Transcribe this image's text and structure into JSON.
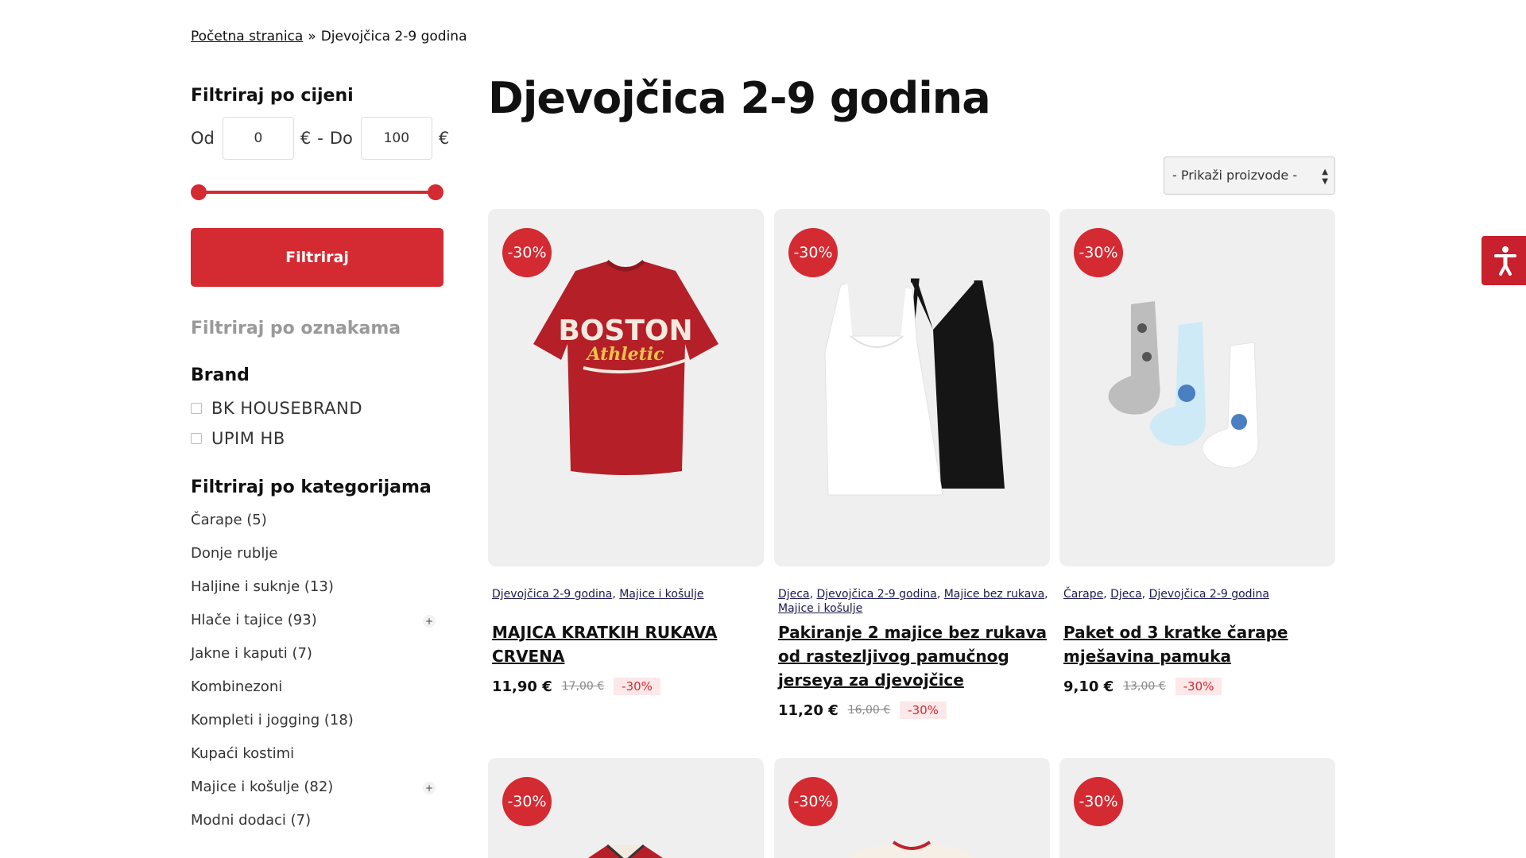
{
  "breadcrumb": {
    "home": "Početna stranica",
    "separator": "»",
    "current": "Djevojčica 2-9 godina"
  },
  "sidebar": {
    "price_title": "Filtriraj po cijeni",
    "price_from_label": "Od",
    "price_from_value": "0",
    "currency": "€",
    "dash": "-",
    "price_to_label": "Do",
    "price_to_value": "100",
    "filter_button": "Filtriraj",
    "tags_title": "Filtriraj po oznakama",
    "brand_title": "Brand",
    "brands": [
      "BK HOUSEBRAND",
      "UPIM HB"
    ],
    "categories_title": "Filtriraj po kategorijama",
    "categories": [
      {
        "label": "Čarape (5)",
        "expandable": false
      },
      {
        "label": "Donje rublje",
        "expandable": false
      },
      {
        "label": "Haljine i suknje (13)",
        "expandable": false
      },
      {
        "label": "Hlače i tajice (93)",
        "expandable": true
      },
      {
        "label": "Jakne i kaputi (7)",
        "expandable": false
      },
      {
        "label": "Kombinezoni",
        "expandable": false
      },
      {
        "label": "Kompleti i jogging (18)",
        "expandable": false
      },
      {
        "label": "Kupaći kostimi",
        "expandable": false
      },
      {
        "label": "Majice i košulje (82)",
        "expandable": true
      },
      {
        "label": "Modni dodaci (7)",
        "expandable": false
      }
    ],
    "expand_symbol": "+"
  },
  "main": {
    "title": "Djevojčica 2-9 godina",
    "sort_select": "- Prikaži proizvode -",
    "products": [
      {
        "badge": "-30%",
        "cats": [
          "Djevojčica 2-9 godina",
          "Majice i košulje"
        ],
        "name": "MAJICA KRATKIH RUKAVA CRVENA",
        "price": "11,90 €",
        "old_price": "17,00 €",
        "discount": "-30%"
      },
      {
        "badge": "-30%",
        "cats": [
          "Djeca",
          "Djevojčica 2-9 godina",
          "Majice bez rukava",
          "Majice i košulje"
        ],
        "name": "Pakiranje 2 majice bez rukava od rastezljivog pamučnog jerseya za djevojčice",
        "price": "11,20 €",
        "old_price": "16,00 €",
        "discount": "-30%"
      },
      {
        "badge": "-30%",
        "cats": [
          "Čarape",
          "Djeca",
          "Djevojčica 2-9 godina"
        ],
        "name": "Paket od 3 kratke čarape mješavina pamuka",
        "price": "9,10 €",
        "old_price": "13,00 €",
        "discount": "-30%"
      },
      {
        "badge": "-30%"
      },
      {
        "badge": "-30%"
      },
      {
        "badge": "-30%"
      }
    ],
    "tshirt_print": {
      "line1": "BOSTON",
      "line2": "Athletic"
    }
  },
  "accessibility": {
    "icon": "accessibility-icon"
  },
  "colors": {
    "accent": "#d42a32",
    "link": "#1a1a4e"
  }
}
